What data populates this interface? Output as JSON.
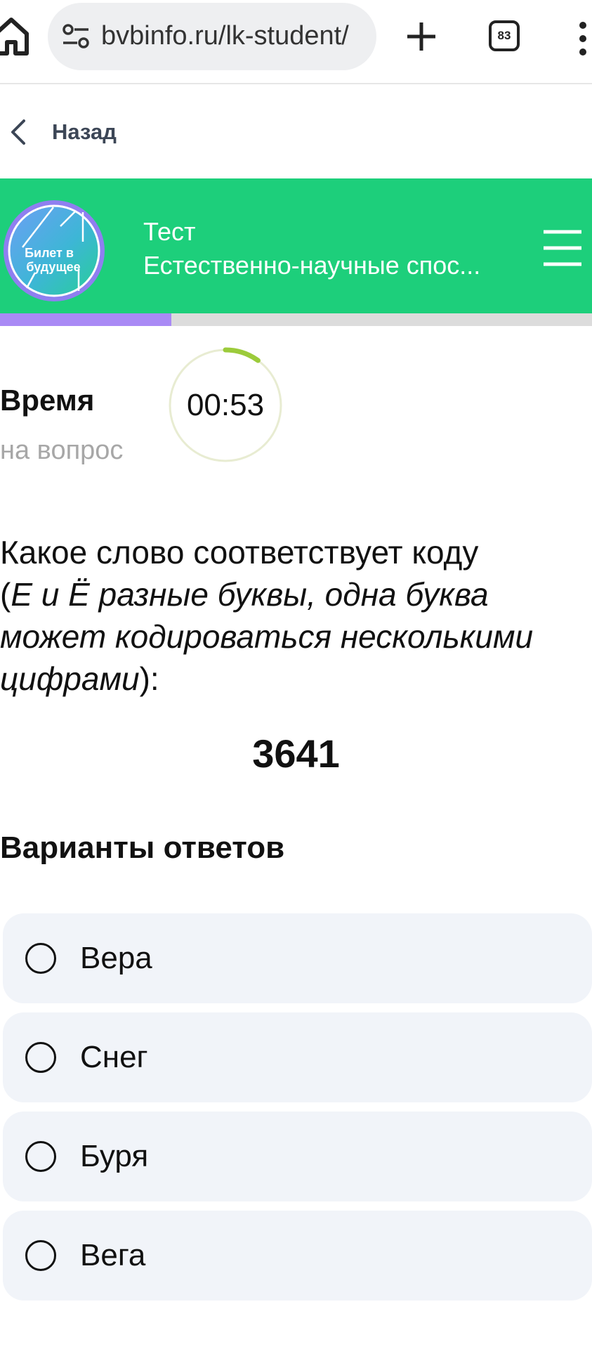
{
  "browser": {
    "url": "bvbinfo.ru/lk-student/",
    "tab_count": "83",
    "icons": [
      "home-icon",
      "site-info-icon",
      "plus-icon",
      "tabs-icon",
      "more-vert-icon"
    ]
  },
  "nav": {
    "back_label": "Назад",
    "icon": "chevron-left-icon"
  },
  "header": {
    "logo_text_line1": "Билет в",
    "logo_text_line2": "будущее",
    "title": "Тест",
    "subtitle": "Естественно-научные спос...",
    "menu_icon": "hamburger-icon"
  },
  "progress": {
    "fraction": 0.29
  },
  "timer": {
    "label": "Время",
    "sublabel": "на вопрос",
    "value": "00:53",
    "remaining_fraction": 0.1
  },
  "question": {
    "lead": "Какое слово соответствует коду",
    "open_paren": "(",
    "note": "Е и Ё разные буквы, одна буква может кодироваться несколькими цифрами",
    "close": "):",
    "code": "3641"
  },
  "answers": {
    "title": "Варианты ответов",
    "options": [
      {
        "label": "Вера"
      },
      {
        "label": "Снег"
      },
      {
        "label": "Буря"
      },
      {
        "label": "Вега"
      }
    ]
  },
  "colors": {
    "header_green": "#1dcf7b",
    "progress_purple": "#a98af5",
    "timer_arc": "#9ccb3b",
    "option_bg": "#f1f4f9"
  }
}
